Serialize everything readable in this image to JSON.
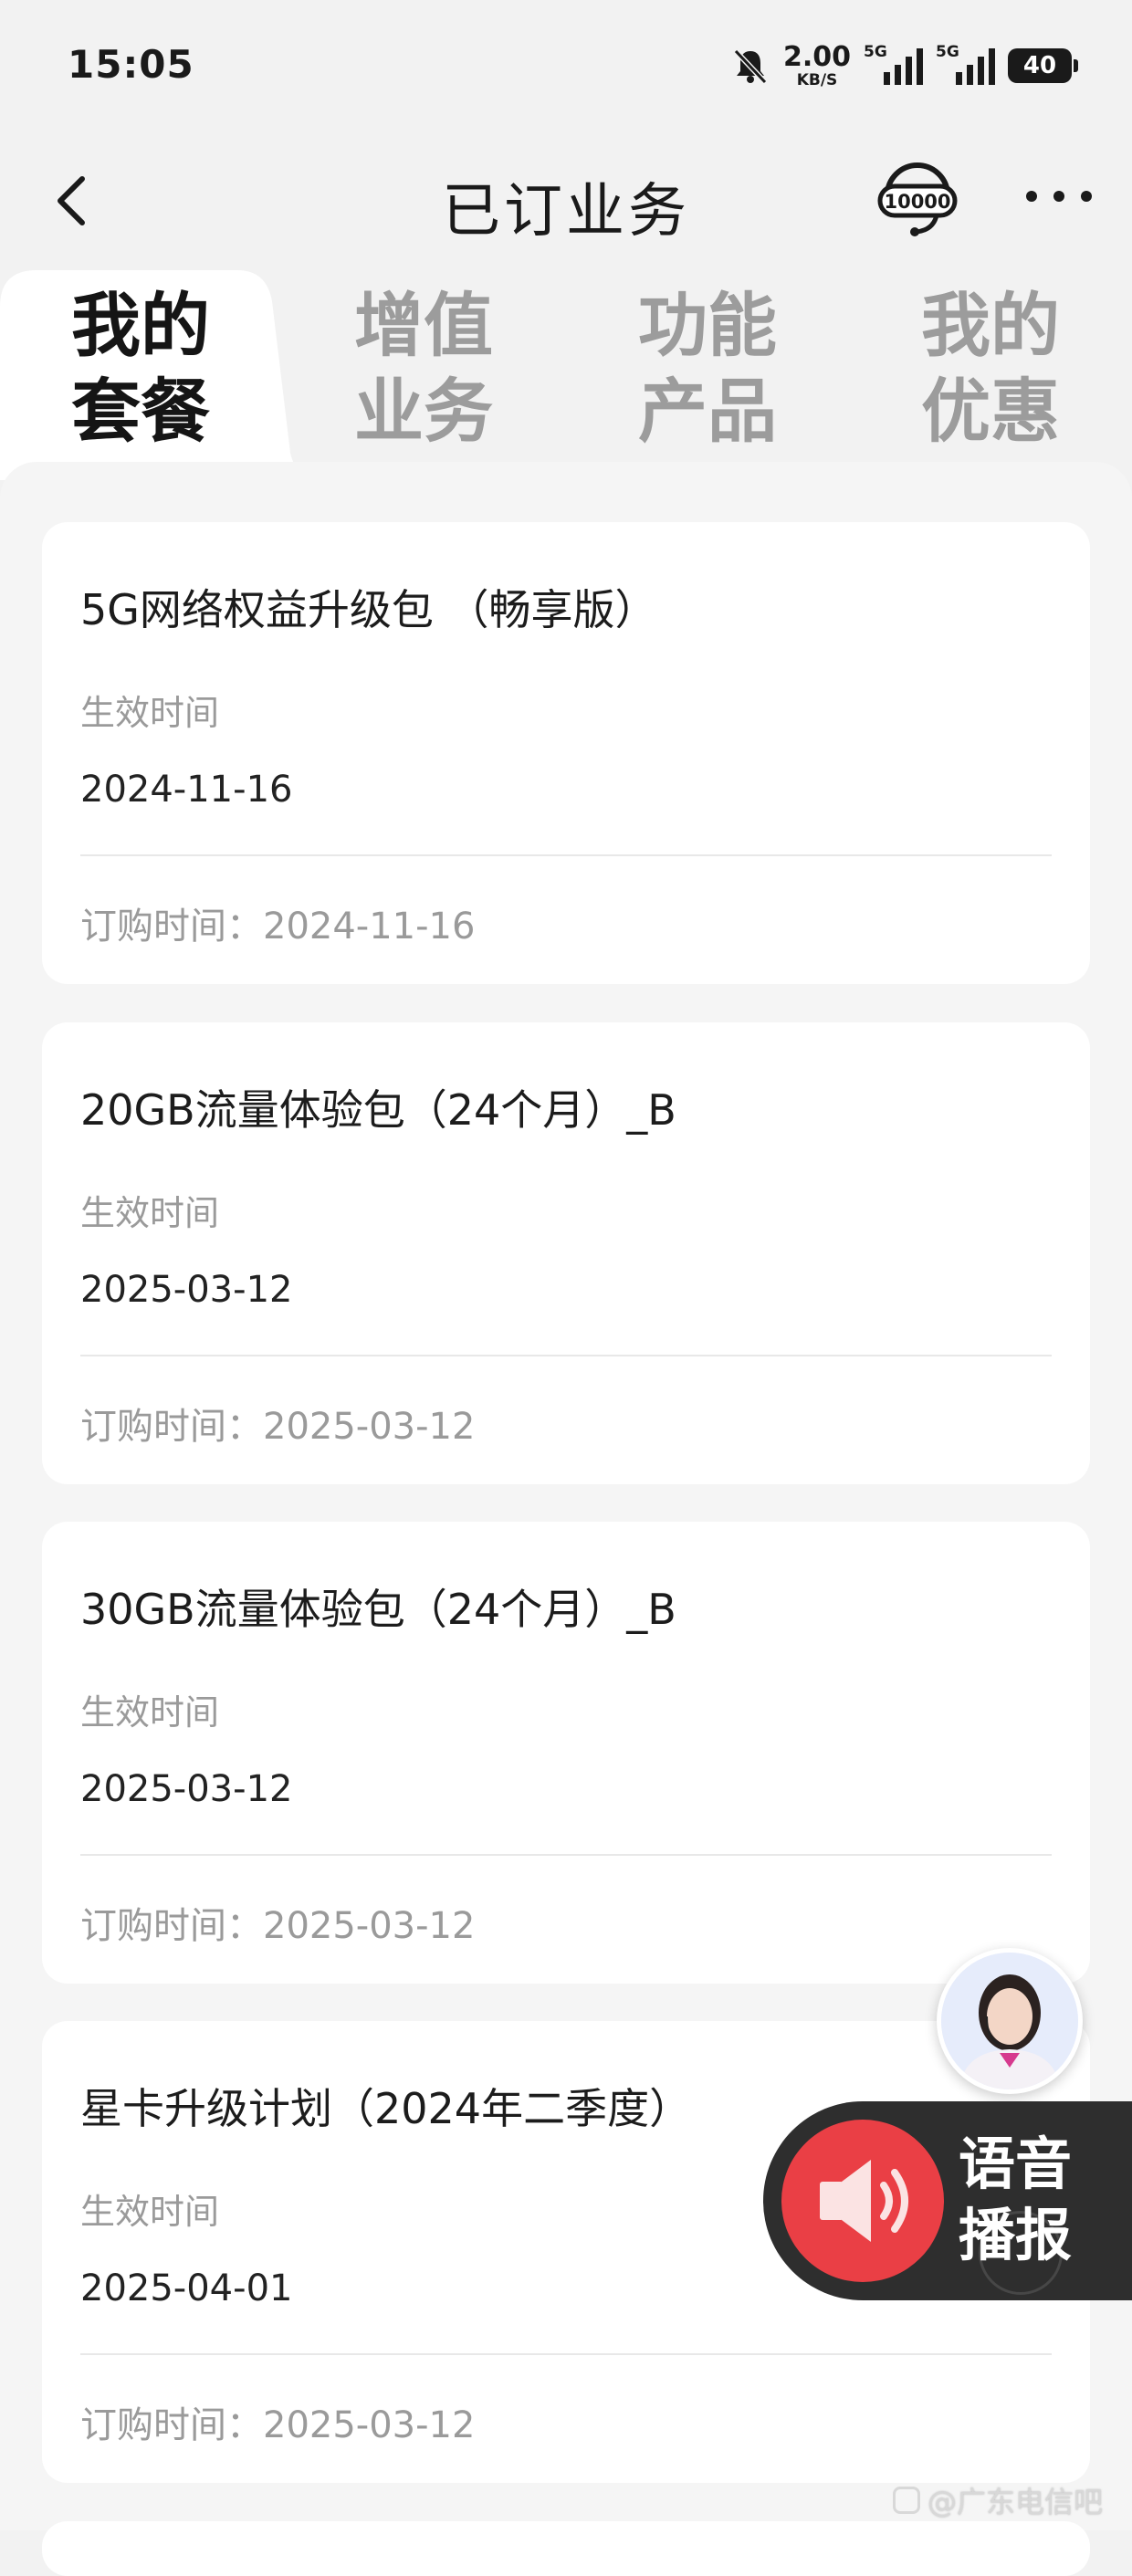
{
  "status_bar": {
    "time": "15:05",
    "speed_value": "2.00",
    "speed_unit": "KB/S",
    "signal1_label": "5G",
    "signal2_label": "5G",
    "battery": "40",
    "icons": [
      "mute-bell-icon",
      "signal-icon",
      "signal-icon",
      "battery-icon"
    ]
  },
  "header": {
    "title": "已订业务",
    "hotline_label": "10000"
  },
  "tabs": [
    {
      "line1": "我的",
      "line2": "套餐",
      "active": true
    },
    {
      "line1": "增值",
      "line2": "业务",
      "active": false
    },
    {
      "line1": "功能",
      "line2": "产品",
      "active": false
    },
    {
      "line1": "我的",
      "line2": "优惠",
      "active": false
    }
  ],
  "cards": [
    {
      "title": "5G网络权益升级包 （畅享版）",
      "effective_label": "生效时间",
      "effective_date": "2024-11-16",
      "order_text": "订购时间：2024-11-16"
    },
    {
      "title": "20GB流量体验包（24个月）_B",
      "effective_label": "生效时间",
      "effective_date": "2025-03-12",
      "order_text": "订购时间：2025-03-12"
    },
    {
      "title": "30GB流量体验包（24个月）_B",
      "effective_label": "生效时间",
      "effective_date": "2025-03-12",
      "order_text": "订购时间：2025-03-12"
    },
    {
      "title": "星卡升级计划（2024年二季度）",
      "effective_label": "生效时间",
      "effective_date": "2025-04-01",
      "order_text": "订购时间：2025-03-12"
    }
  ],
  "voice": {
    "line1": "语音",
    "line2": "播报",
    "icon": "speaker-icon"
  },
  "watermark": "@广东电信吧",
  "colors": {
    "background": "#f2f2f2",
    "card": "#ffffff",
    "voice_panel": "#2e2e2e",
    "voice_button": "#ea3f45"
  }
}
